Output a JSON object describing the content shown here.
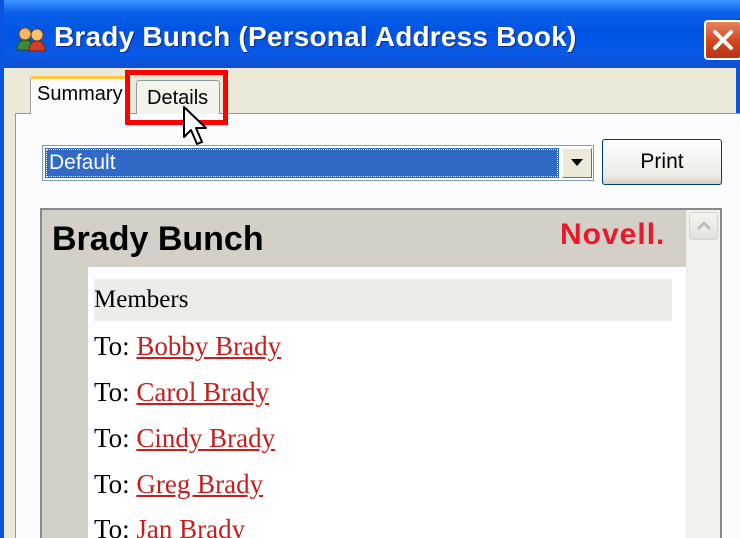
{
  "window": {
    "title": "Brady Bunch (Personal Address Book)",
    "title_icon": "group-users-icon",
    "close_icon": "close-icon",
    "colors": {
      "titlebar": "#0054e3",
      "close": "#d1451e",
      "highlight": "#ff0000"
    }
  },
  "tabs": [
    {
      "label": "Summary",
      "selected": true
    },
    {
      "label": "Details",
      "selected": false
    }
  ],
  "view_select": {
    "value": "Default"
  },
  "print_button": {
    "label": "Print"
  },
  "card": {
    "name": "Brady Bunch",
    "logo": "Novell.",
    "members_header": "Members",
    "members": [
      {
        "prefix": "To:",
        "name": "Bobby Brady"
      },
      {
        "prefix": "To:",
        "name": "Carol Brady"
      },
      {
        "prefix": "To:",
        "name": "Cindy Brady"
      },
      {
        "prefix": "To:",
        "name": "Greg Brady"
      },
      {
        "prefix": "To:",
        "name": "Jan Brady"
      }
    ],
    "colors": {
      "link": "#c41e1e",
      "logo": "#e8192c",
      "band": "#d4d0c8"
    }
  }
}
